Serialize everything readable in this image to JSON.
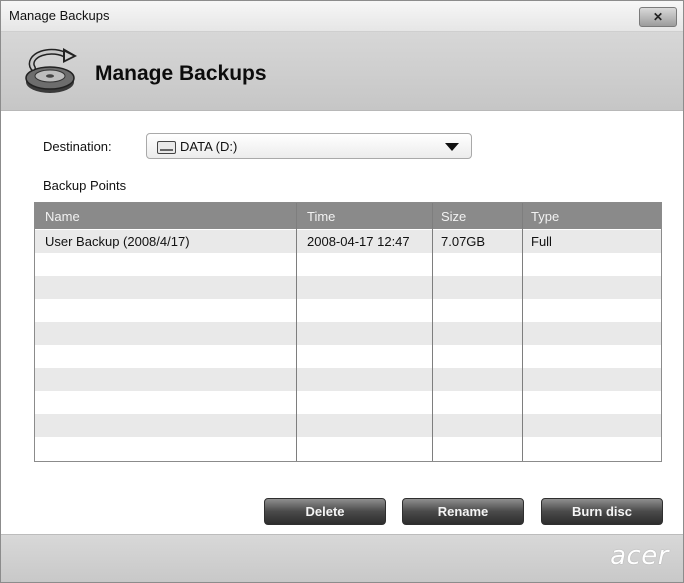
{
  "window": {
    "title": "Manage Backups",
    "close_label": "✕"
  },
  "header": {
    "title": "Manage Backups",
    "icon": "backup-disk-icon"
  },
  "destination": {
    "label": "Destination:",
    "value": "DATA (D:)",
    "icon": "drive-icon"
  },
  "backup_points": {
    "label": "Backup Points",
    "columns": [
      "Name",
      "Time",
      "Size",
      "Type"
    ],
    "rows": [
      {
        "name": "User Backup (2008/4/17)",
        "time": "2008-04-17 12:47",
        "size": "7.07GB",
        "type": "Full"
      }
    ]
  },
  "buttons": {
    "delete": "Delete",
    "rename": "Rename",
    "burn_disc": "Burn disc"
  },
  "footer": {
    "brand": "acer"
  }
}
